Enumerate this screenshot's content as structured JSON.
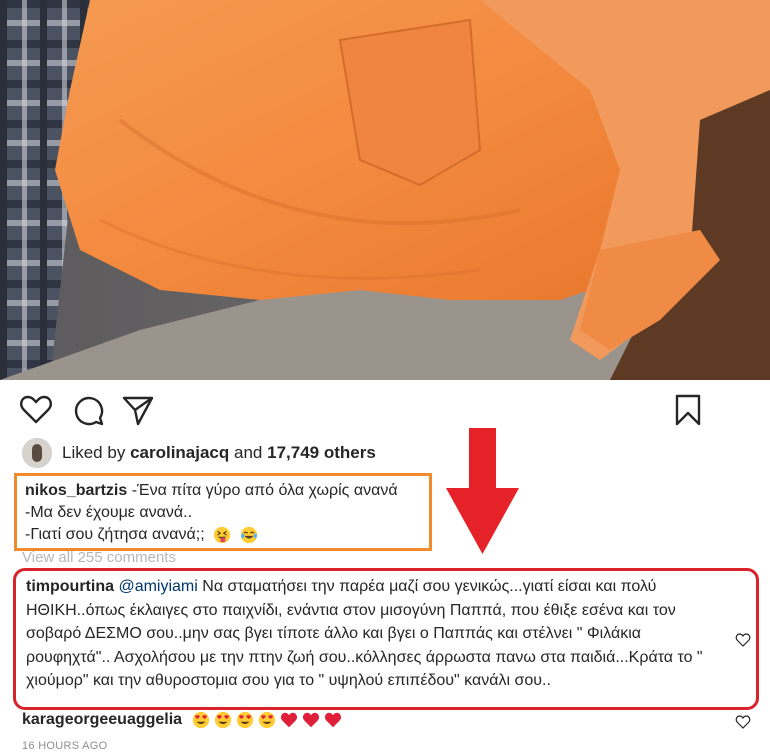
{
  "post": {
    "liked_by_prefix": "Liked by",
    "liked_by_user": "carolinajacq",
    "liked_by_and": "and",
    "liked_by_count": "17,749 others"
  },
  "caption": {
    "username": "nikos_bartzis",
    "line1": "-Ένα πίτα γύρο από όλα χωρίς ανανά",
    "line2": "-Μα δεν έχουμε ανανά..",
    "line3": "-Γιατί σου ζήτησα ανανά;;"
  },
  "view_all_comments": "View all 255 comments",
  "comments": [
    {
      "username": "timpourtina",
      "mention": "@amiyiami",
      "text": "Να σταματήσει την παρέα μαζί σου γενικώς...γιατί είσαι και πολύ ΗΘΙΚΗ..όπως έκλαιγες στο παιχνίδι, ενάντια στον μισογύνη Παππά, που έθιξε εσένα και τον σοβαρό ΔΕΣΜΟ σου..μην σας βγει τίποτε άλλο και βγει ο Παππάς και στέλνει \" Φιλάκια ρουφηχτά\".. Ασχολήσου με την πτην ζωή σου..κόλλησες άρρωστα πανω στα παιδιά...Κράτα το \" χιούμορ\" και την αθυροστομια σου για το \" υψηλού επιπέδου\" κανάλι σου.."
    },
    {
      "username": "karageorgeeuaggelia"
    }
  ],
  "timestamp": "16 HOURS AGO",
  "icons": [
    "heart-icon",
    "comment-icon",
    "share-icon",
    "bookmark-icon"
  ],
  "colors": {
    "caption_highlight": "#f08a2b",
    "comment_highlight": "#d8232a",
    "arrow": "#e52228",
    "mention": "#00376b"
  }
}
